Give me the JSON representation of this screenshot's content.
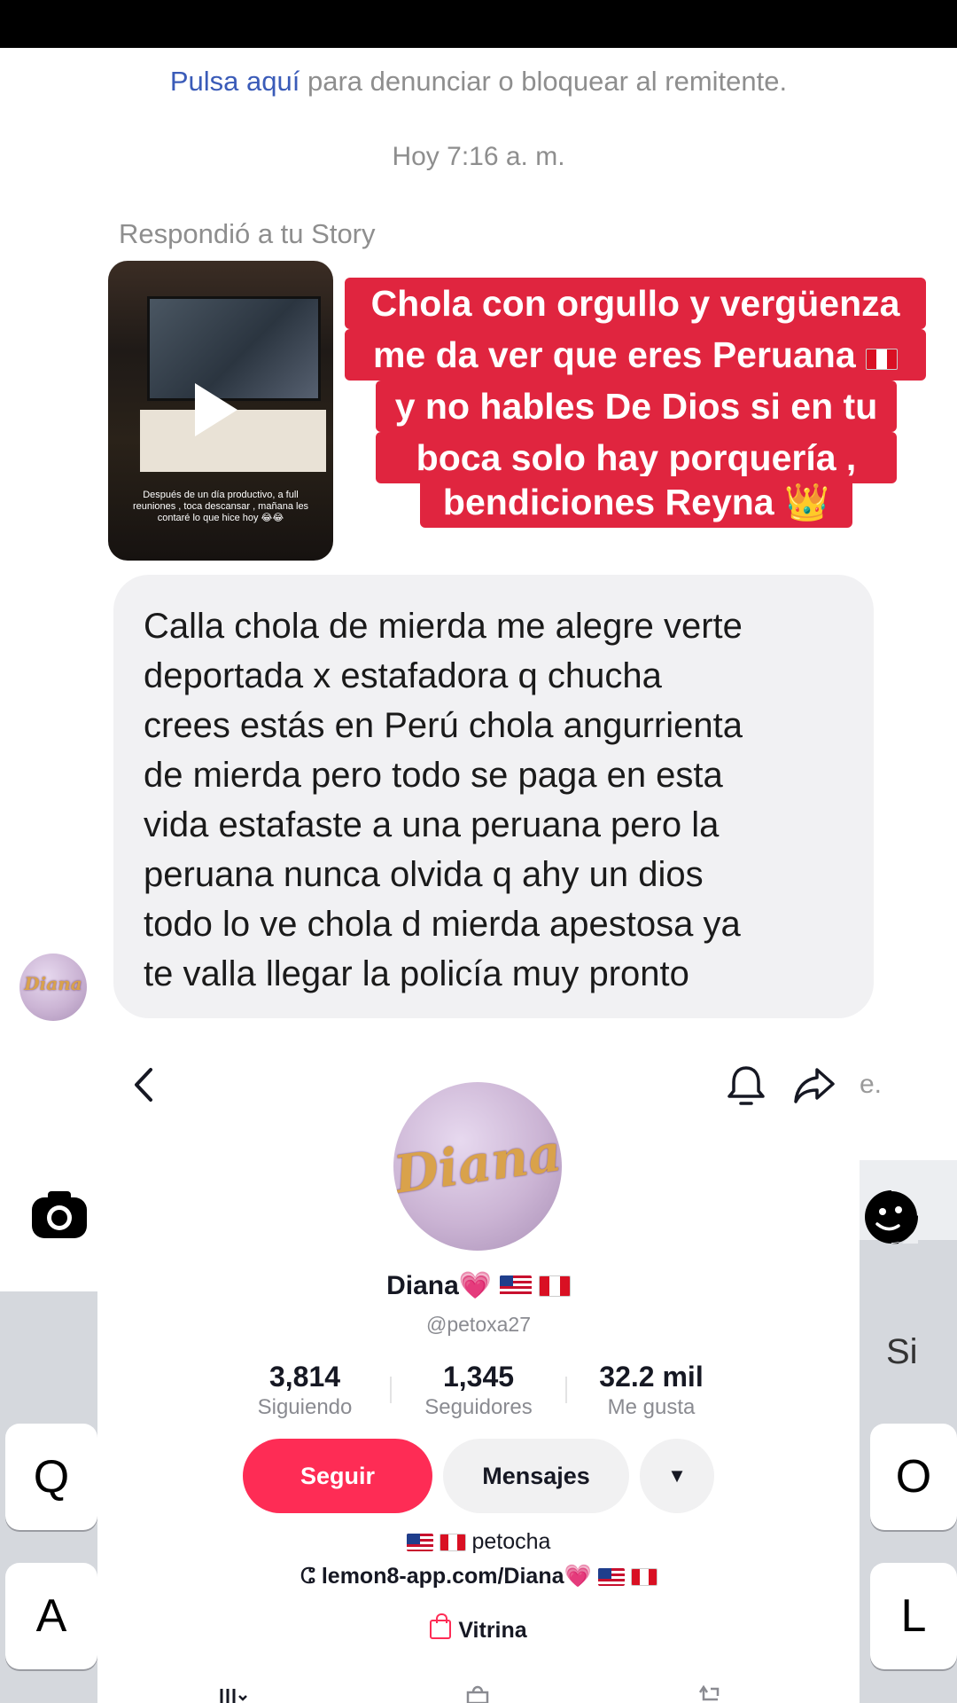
{
  "report": {
    "link": "Pulsa aquí",
    "text": " para denunciar o bloquear al remitente."
  },
  "timestamp": "Hoy 7:16 a. m.",
  "story": {
    "replied_label": "Respondió a tu Story",
    "caption": "Después de un día productivo, a full reuniones , toca descansar , mañana les contaré lo que hice hoy 😂😂"
  },
  "overlay": {
    "line1": "Chola con orgullo y vergüenza",
    "line2": "me da ver que eres Peruana",
    "line3": "y no hables De Dios si en tu",
    "line4": "boca solo hay porquería ,",
    "line5": "bendiciones Reyna",
    "crown_emoji": "👑"
  },
  "message": {
    "text": "Calla chola de mierda me alegre verte\ndeportada x estafadora q chucha\ncrees estás en Perú chola angurrienta\nde mierda  pero todo se paga en esta\nvida estafaste  a una peruana pero la\nperuana nunca olvida q ahy un dios\ntodo lo ve chola d mierda apestosa ya\nte valla llegar la policía muy pronto"
  },
  "avatar_logo": "Diana",
  "edge_text": "e.",
  "keyboard": {
    "q": "Q",
    "a": "A",
    "o": "O",
    "l": "L",
    "suggestion": "Si"
  },
  "profile": {
    "name": "Diana",
    "heart": "💗",
    "handle": "@petoxa27",
    "stats": [
      {
        "value": "3,814",
        "label": "Siguiendo"
      },
      {
        "value": "1,345",
        "label": "Seguidores"
      },
      {
        "value": "32.2 mil",
        "label": "Me gusta"
      }
    ],
    "follow_label": "Seguir",
    "message_label": "Mensajes",
    "more_label": "▼",
    "bio": "petocha",
    "link_icon": "ⵛ",
    "link": "lemon8-app.com/Diana",
    "showcase": "Vitrina"
  },
  "colors": {
    "overlay_red": "#e0253f",
    "follow_pink": "#fe2c55",
    "link_blue": "#3a5bb8"
  },
  "icons": [
    "back-icon",
    "bell-icon",
    "share-icon",
    "camera-icon",
    "sticker-icon",
    "play-icon",
    "bag-icon",
    "link-icon"
  ]
}
